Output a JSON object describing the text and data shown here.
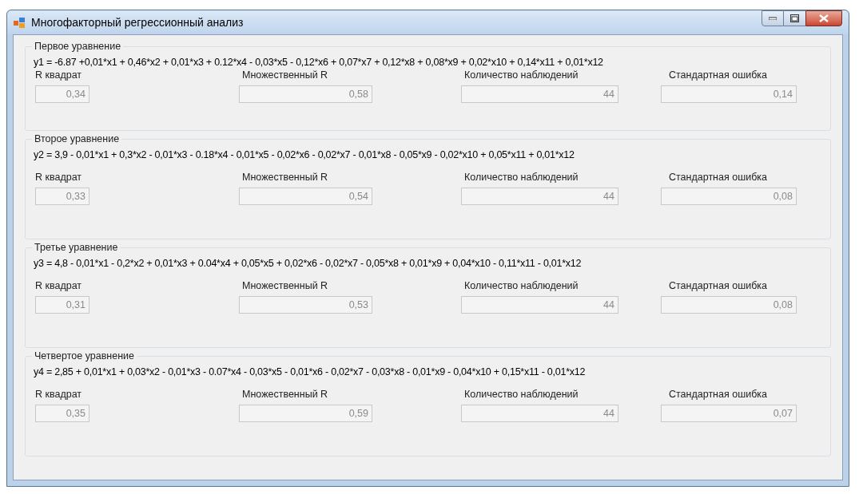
{
  "window": {
    "title": "Многофакторный регрессионный анализ"
  },
  "groups": [
    {
      "title": "Первое уравнение",
      "equation": "y1 = -6.87 +0,01*x1 + 0,46*x2 + 0,01*x3 + 0.12*x4 - 0,03*x5 - 0,12*x6 + 0,07*x7 + 0,12*x8 + 0,08*x9 + 0,02*x10 + 0,14*x11 + 0,01*x12",
      "fields": [
        {
          "label": "R квадрат",
          "value": "0,34",
          "disabled": true
        },
        {
          "label": "Множественный R",
          "value": "0,58",
          "disabled": true
        },
        {
          "label": "Количество наблюдений",
          "value": "44",
          "disabled": true
        },
        {
          "label": "Стандартная ошибка",
          "value": "0,14",
          "disabled": true
        }
      ]
    },
    {
      "title": "Второе уравнение",
      "equation": "y2 = 3,9 - 0,01*x1 + 0,3*x2 - 0,01*x3 - 0.18*x4 - 0,01*x5 - 0,02*x6 - 0,02*x7 - 0,01*x8 - 0,05*x9 - 0,02*x10 + 0,05*x11 + 0,01*x12",
      "fields": [
        {
          "label": "R квадрат",
          "value": "0,33",
          "disabled": true
        },
        {
          "label": "Множественный R",
          "value": "0,54",
          "disabled": true
        },
        {
          "label": "Количество наблюдений",
          "value": "44",
          "disabled": true
        },
        {
          "label": "Стандартная ошибка",
          "value": "0,08",
          "disabled": true
        }
      ]
    },
    {
      "title": "Третье уравнение",
      "equation": "y3 = 4,8 - 0,01*x1 - 0,2*x2 + 0,01*x3 + 0.04*x4 + 0,05*x5 + 0,02*x6 - 0,02*x7 - 0,05*x8 + 0,01*x9 + 0,04*x10 - 0,11*x11 - 0,01*x12",
      "fields": [
        {
          "label": "R квадрат",
          "value": "0,31",
          "disabled": true
        },
        {
          "label": "Множественный R",
          "value": "0,53",
          "disabled": true
        },
        {
          "label": "Количество наблюдений",
          "value": "44",
          "disabled": true
        },
        {
          "label": "Стандартная ошибка",
          "value": "0,08",
          "disabled": true
        }
      ]
    },
    {
      "title": "Четвертое уравнение",
      "equation": "y4 = 2,85 + 0,01*x1 + 0,03*x2 - 0,01*x3 - 0.07*x4 - 0,03*x5 - 0,01*x6 - 0,02*x7 - 0,03*x8 - 0,01*x9 - 0,04*x10 + 0,15*x11 - 0,01*x12",
      "fields": [
        {
          "label": "R квадрат",
          "value": "0,35",
          "disabled": true
        },
        {
          "label": "Множественный R",
          "value": "0,59",
          "disabled": true
        },
        {
          "label": "Количество наблюдений",
          "value": "44",
          "disabled": true
        },
        {
          "label": "Стандартная ошибка",
          "value": "0,07",
          "disabled": true
        }
      ]
    }
  ]
}
